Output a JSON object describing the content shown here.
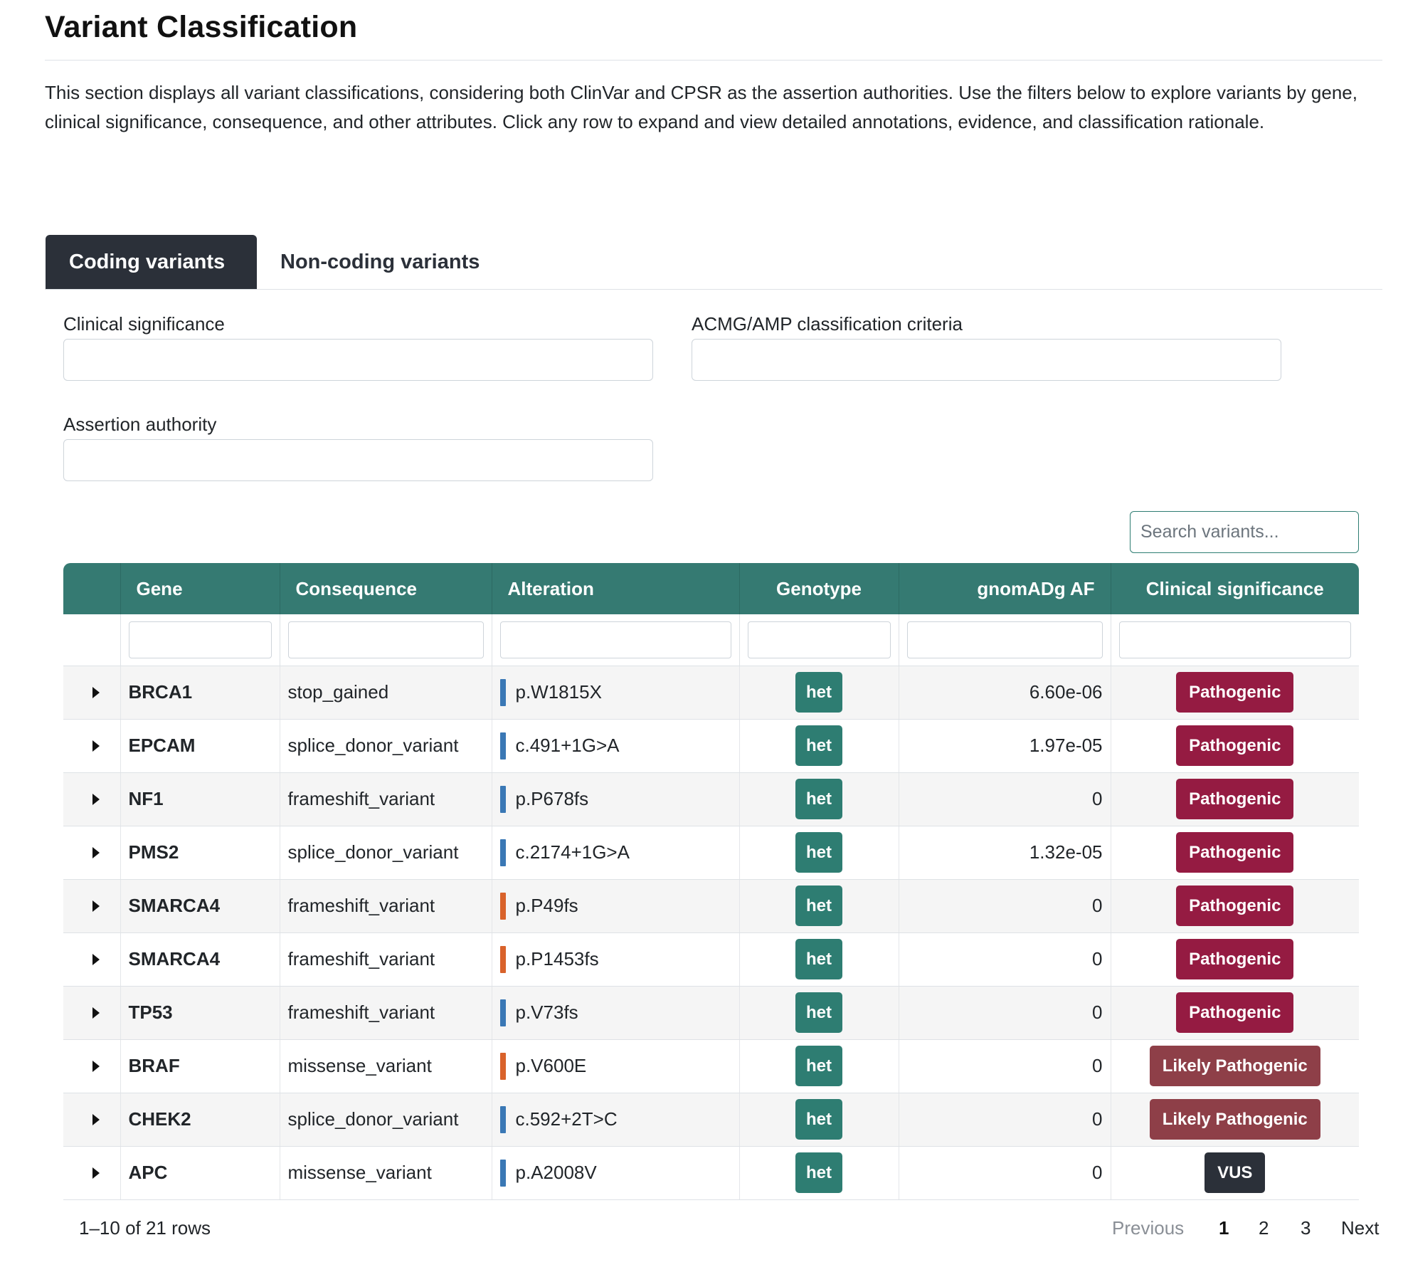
{
  "page": {
    "title": "Variant Classification",
    "intro": "This section displays all variant classifications, considering both ClinVar and CPSR as the assertion authorities. Use the filters below to explore variants by gene, clinical significance, consequence, and other attributes. Click any row to expand and view detailed annotations, evidence, and classification rationale."
  },
  "tabs": [
    {
      "label": "Coding variants",
      "active": true
    },
    {
      "label": "Non-coding variants",
      "active": false
    }
  ],
  "filters": {
    "clinical_significance": "Clinical significance",
    "acmg_criteria": "ACMG/AMP classification criteria",
    "assertion_authority": "Assertion authority"
  },
  "search": {
    "placeholder": "Search variants..."
  },
  "table": {
    "headers": [
      "",
      "Gene",
      "Consequence",
      "Alteration",
      "Genotype",
      "gnomADg AF",
      "Clinical significance"
    ],
    "rows": [
      {
        "gene": "BRCA1",
        "consequence": "stop_gained",
        "alteration": "p.W1815X",
        "bar_color": "#3a78b5",
        "genotype": "het",
        "af": "6.60e-06",
        "significance": "Pathogenic"
      },
      {
        "gene": "EPCAM",
        "consequence": "splice_donor_variant",
        "alteration": "c.491+1G>A",
        "bar_color": "#3a78b5",
        "genotype": "het",
        "af": "1.97e-05",
        "significance": "Pathogenic"
      },
      {
        "gene": "NF1",
        "consequence": "frameshift_variant",
        "alteration": "p.P678fs",
        "bar_color": "#3a78b5",
        "genotype": "het",
        "af": "0",
        "significance": "Pathogenic"
      },
      {
        "gene": "PMS2",
        "consequence": "splice_donor_variant",
        "alteration": "c.2174+1G>A",
        "bar_color": "#3a78b5",
        "genotype": "het",
        "af": "1.32e-05",
        "significance": "Pathogenic"
      },
      {
        "gene": "SMARCA4",
        "consequence": "frameshift_variant",
        "alteration": "p.P49fs",
        "bar_color": "#d9622b",
        "genotype": "het",
        "af": "0",
        "significance": "Pathogenic"
      },
      {
        "gene": "SMARCA4",
        "consequence": "frameshift_variant",
        "alteration": "p.P1453fs",
        "bar_color": "#d9622b",
        "genotype": "het",
        "af": "0",
        "significance": "Pathogenic"
      },
      {
        "gene": "TP53",
        "consequence": "frameshift_variant",
        "alteration": "p.V73fs",
        "bar_color": "#3a78b5",
        "genotype": "het",
        "af": "0",
        "significance": "Pathogenic"
      },
      {
        "gene": "BRAF",
        "consequence": "missense_variant",
        "alteration": "p.V600E",
        "bar_color": "#d9622b",
        "genotype": "het",
        "af": "0",
        "significance": "Likely Pathogenic"
      },
      {
        "gene": "CHEK2",
        "consequence": "splice_donor_variant",
        "alteration": "c.592+2T>C",
        "bar_color": "#3a78b5",
        "genotype": "het",
        "af": "0",
        "significance": "Likely Pathogenic"
      },
      {
        "gene": "APC",
        "consequence": "missense_variant",
        "alteration": "p.A2008V",
        "bar_color": "#3a78b5",
        "genotype": "het",
        "af": "0",
        "significance": "VUS"
      }
    ]
  },
  "significance_colors": {
    "Pathogenic": "#951b42",
    "Likely Pathogenic": "#8e3f48",
    "VUS": "#2b3039"
  },
  "pagination": {
    "summary": "1–10 of 21 rows",
    "previous": "Previous",
    "pages": [
      "1",
      "2",
      "3"
    ],
    "current": "1",
    "next": "Next"
  }
}
